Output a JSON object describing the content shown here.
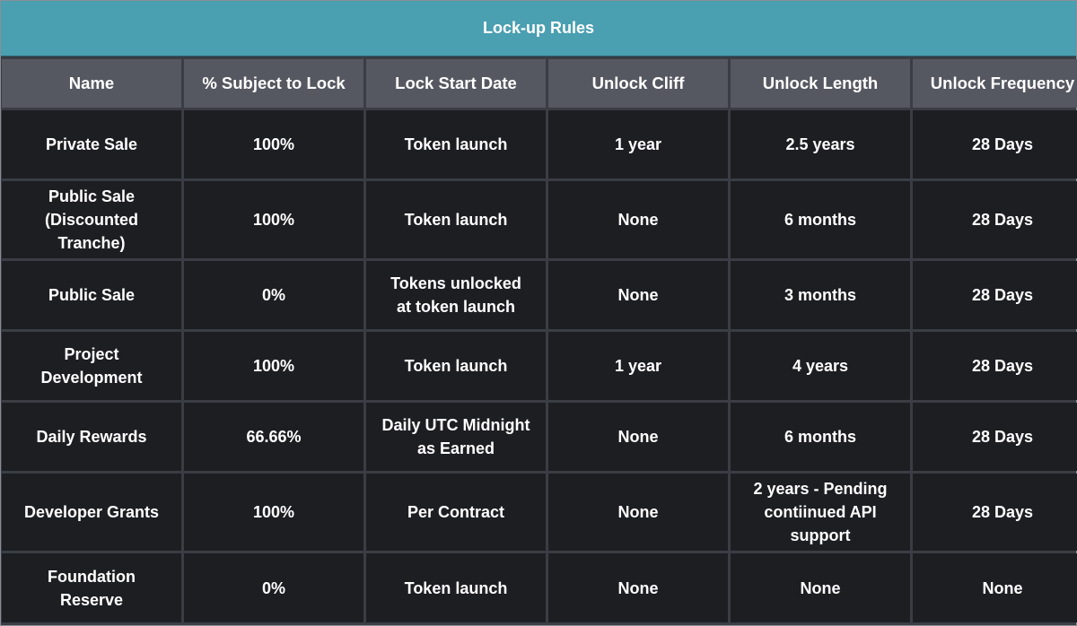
{
  "title": "Lock-up Rules",
  "columns": [
    "Name",
    "% Subject to Lock",
    "Lock Start Date",
    "Unlock Cliff",
    "Unlock Length",
    "Unlock Frequency"
  ],
  "rows": [
    [
      "Private Sale",
      "100%",
      "Token launch",
      "1 year",
      "2.5 years",
      "28 Days"
    ],
    [
      "Public Sale (Discounted Tranche)",
      "100%",
      "Token launch",
      "None",
      "6 months",
      "28 Days"
    ],
    [
      "Public Sale",
      "0%",
      "Tokens unlocked at token launch",
      "None",
      "3 months",
      "28 Days"
    ],
    [
      "Project Development",
      "100%",
      "Token launch",
      "1 year",
      "4 years",
      "28 Days"
    ],
    [
      "Daily Rewards",
      "66.66%",
      "Daily UTC Midnight as Earned",
      "None",
      "6 months",
      "28 Days"
    ],
    [
      "Developer Grants",
      "100%",
      "Per Contract",
      "None",
      "2 years - Pending contiinued API support",
      "28 Days"
    ],
    [
      "Foundation Reserve",
      "0%",
      "Token launch",
      "None",
      "None",
      "None"
    ]
  ],
  "colors": {
    "title_bar": "#4a9fb1",
    "header_cell": "#565861",
    "body_cell": "#1d1e22",
    "grid": "#3a3d44",
    "text": "#ffffff"
  }
}
